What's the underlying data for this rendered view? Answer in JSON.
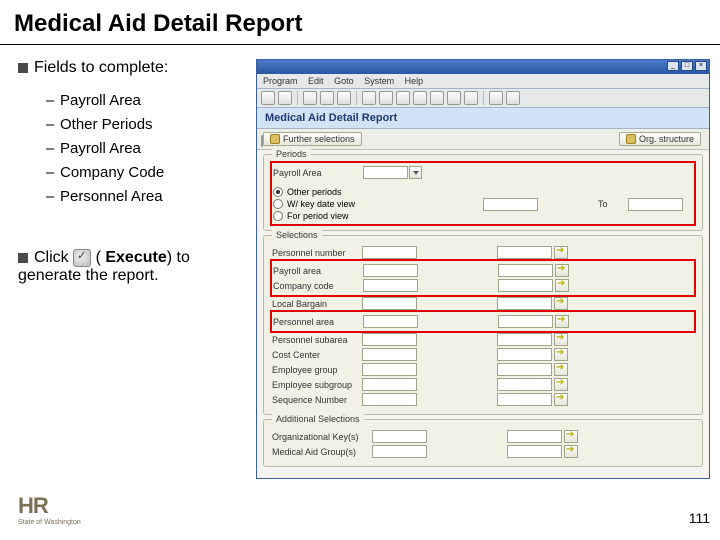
{
  "title": "Medical Aid Detail Report",
  "fields_heading": "Fields to complete:",
  "sublist": [
    "Payroll Area",
    "Other Periods",
    "Payroll Area",
    "Company Code",
    "Personnel Area"
  ],
  "click_pre": "Click",
  "click_exec": "Execute",
  "click_post": ") to generate the report.",
  "sap": {
    "menu": [
      "Program",
      "Edit",
      "Goto",
      "System",
      "Help"
    ],
    "screen_title": "Medical Aid Detail Report",
    "btn_further": "Further selections",
    "btn_orgstruct": "Org. structure",
    "panel_periods": "Periods",
    "payroll_area_label": "Payroll Area",
    "radio_other": "Other periods",
    "radio_wkeydate": "W/ key date view",
    "radio_periodview": "For period view",
    "to_label": "To",
    "panel_selections": "Selections",
    "sel_labels": [
      "Personnel number",
      "Payroll area",
      "Company code",
      "Local Bargain",
      "Personnel area",
      "Personnel subarea",
      "Cost Center",
      "Employee group",
      "Employee subgroup",
      "Sequence Number"
    ],
    "panel_addl": "Additional Selections",
    "addl_labels": [
      "Organizational Key(s)",
      "Medical Aid Group(s)"
    ]
  },
  "footer": {
    "hr": "HR",
    "sow": "State of Washington"
  },
  "page_number": "111"
}
